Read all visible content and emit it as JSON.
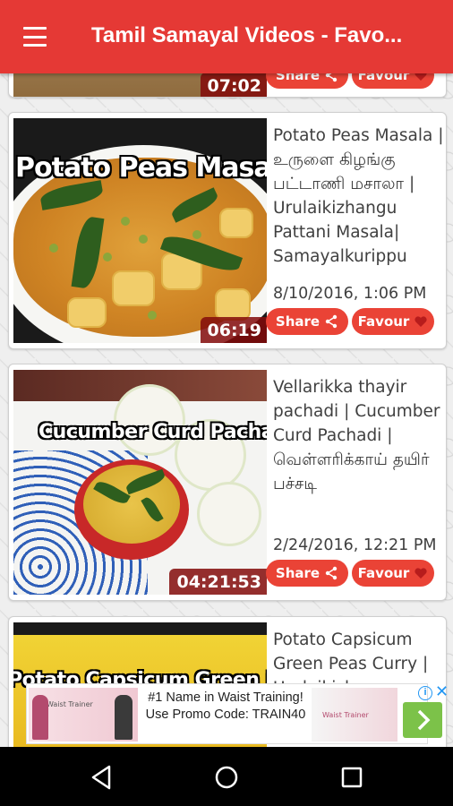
{
  "app": {
    "title": "Tamil Samayal Videos - Favo..."
  },
  "partial_card": {
    "duration": "07:02",
    "share_label": "Share",
    "favour_label": "Favour"
  },
  "videos": [
    {
      "thumb_title": "Potato Peas Masala",
      "duration": "06:19",
      "title": "Potato Peas Masala | உருளை கிழங்கு பட்டாணி மசாலா | Urulaikizhangu Pattani  Masala| Samayalkurippu",
      "date": "8/10/2016, 1:06 PM",
      "share_label": "Share",
      "favour_label": "Favour"
    },
    {
      "thumb_title": "Cucumber Curd Pachadi",
      "duration": "04:21:53",
      "title": "Vellarikka thayir pachadi | Cucumber Curd Pachadi | வெள்ளரிக்காய் தயிர் பச்சடி",
      "date": "2/24/2016, 12:21 PM",
      "share_label": "Share",
      "favour_label": "Favour"
    },
    {
      "thumb_title": "Potato Capsicum Green Peas Cu",
      "title": "Potato Capsicum Green Peas Curry | Urulaikizhangu"
    }
  ],
  "ad": {
    "text": "#1 Name in Waist Training! Use Promo Code: TRAIN40",
    "left_caption": "Waist Trainer",
    "right_caption": "Waist Trainer"
  },
  "colors": {
    "primary": "#e53935",
    "button": "#ea4336",
    "heart": "#b71c1c"
  }
}
